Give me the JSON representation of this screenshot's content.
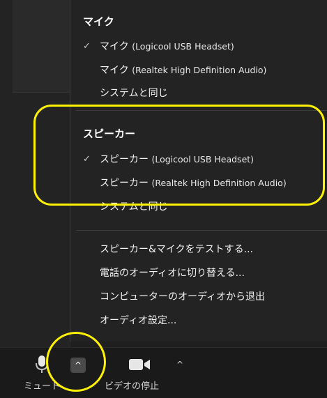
{
  "menu": {
    "microphone": {
      "title": "マイク",
      "items": [
        {
          "label": "マイク",
          "device": "(Logicool USB Headset)",
          "check": "✓"
        },
        {
          "label": "マイク",
          "device": "(Realtek High Definition Audio)",
          "check": ""
        },
        {
          "label": "システムと同じ",
          "device": "",
          "check": ""
        }
      ]
    },
    "speaker": {
      "title": "スピーカー",
      "items": [
        {
          "label": "スピーカー",
          "device": "(Logicool USB Headset)",
          "check": "✓"
        },
        {
          "label": "スピーカー",
          "device": "(Realtek High Definition Audio)",
          "check": ""
        },
        {
          "label": "システムと同じ",
          "device": "",
          "check": ""
        }
      ]
    },
    "actions": [
      {
        "label": "スピーカー&マイクをテストする..."
      },
      {
        "label": "電話のオーディオに切り替える..."
      },
      {
        "label": "コンピューターのオーディオから退出"
      },
      {
        "label": "オーディオ設定..."
      }
    ]
  },
  "toolbar": {
    "mute_label": "ミュート",
    "video_label": "ビデオの停止",
    "caret_glyph": "^"
  },
  "colors": {
    "background": "#1f1f1f",
    "menu_bg": "#232323",
    "highlight": "#fff200",
    "text": "#ffffff"
  }
}
